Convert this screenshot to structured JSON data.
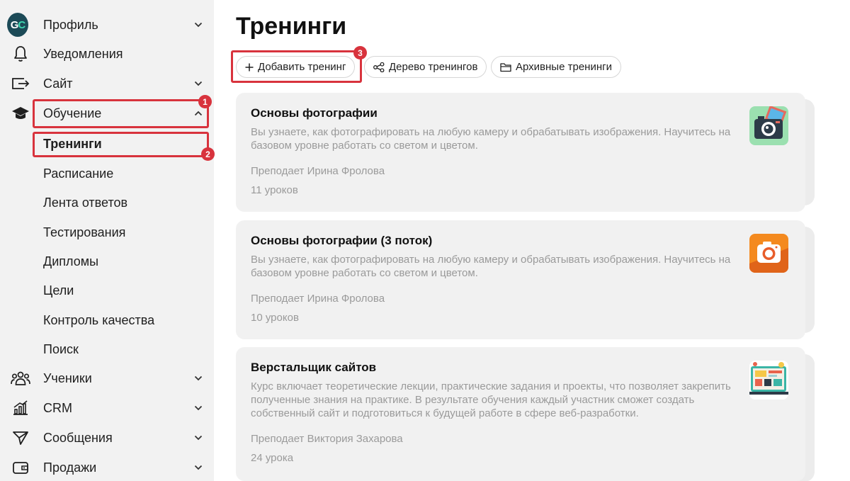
{
  "sidebar": {
    "logo_text_g": "G",
    "logo_text_c": "C",
    "items": [
      {
        "label": "Профиль",
        "icon": "logo-icon"
      },
      {
        "label": "Уведомления",
        "icon": "bell-icon"
      },
      {
        "label": "Сайт",
        "icon": "site-icon"
      },
      {
        "label": "Обучение",
        "icon": "graduation-cap-icon"
      },
      {
        "label": "Ученики",
        "icon": "users-icon"
      },
      {
        "label": "CRM",
        "icon": "chart-icon"
      },
      {
        "label": "Сообщения",
        "icon": "send-icon"
      },
      {
        "label": "Продажи",
        "icon": "wallet-icon"
      }
    ],
    "sub_items": [
      {
        "label": "Тренинги"
      },
      {
        "label": "Расписание"
      },
      {
        "label": "Лента ответов"
      },
      {
        "label": "Тестирования"
      },
      {
        "label": "Дипломы"
      },
      {
        "label": "Цели"
      },
      {
        "label": "Контроль качества"
      },
      {
        "label": "Поиск"
      }
    ]
  },
  "annotations": {
    "badge1": "1",
    "badge2": "2",
    "badge3": "3"
  },
  "main": {
    "title": "Тренинги",
    "toolbar": {
      "add": "Добавить тренинг",
      "tree": "Дерево тренингов",
      "archive": "Архивные тренинги"
    },
    "trainings": [
      {
        "title": "Основы фотографии",
        "description": "Вы узнаете, как фотографировать на любую камеру и обрабатывать изображения. Научитесь на базовом уровне работать со светом и цветом.",
        "teacher": "Преподает Ирина Фролова",
        "lessons": "11 уроков",
        "icon": "camera-green-icon"
      },
      {
        "title": "Основы фотографии (3 поток)",
        "description": "Вы узнаете, как фотографировать на любую камеру и обрабатывать изображения. Научитесь на базовом уровне работать со светом и цветом.",
        "teacher": "Преподает Ирина Фролова",
        "lessons": "10 уроков",
        "icon": "camera-orange-icon"
      },
      {
        "title": "Верстальщик сайтов",
        "description": "Курс включает теоретические лекции, практические задания и проекты, что позволяет закрепить полученные знания на практике. В результате обучения каждый участник сможет создать собственный сайт и подготовиться к будущей работе в сфере веб-разработки.",
        "teacher": "Преподает Виктория Захарова",
        "lessons": "24 урока",
        "icon": "webdesign-icon"
      }
    ]
  },
  "colors": {
    "accent_red": "#d8333d",
    "sidebar_bg": "#f2f2f2",
    "card_bg": "#f1f1f1",
    "muted_text": "#9a9a9a"
  }
}
